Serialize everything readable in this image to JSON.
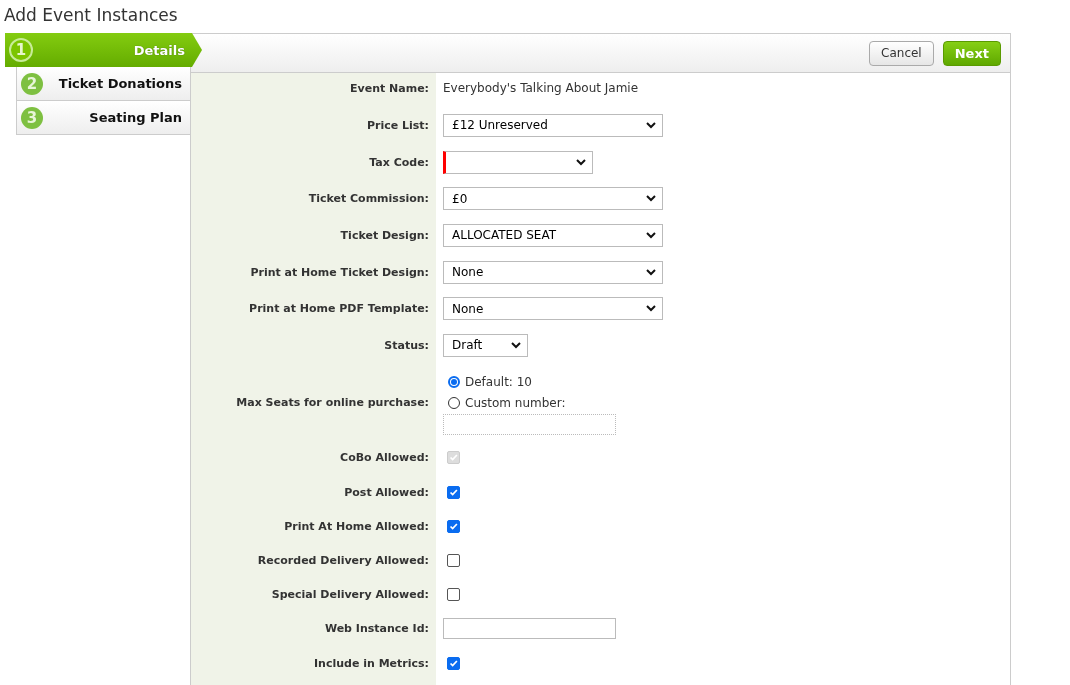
{
  "page_title": "Add Event Instances",
  "steps": [
    {
      "number": "1",
      "label": "Details",
      "selected": true
    },
    {
      "number": "2",
      "label": "Ticket Donations",
      "selected": false
    },
    {
      "number": "3",
      "label": "Seating Plan",
      "selected": false
    }
  ],
  "buttons": [
    {
      "label": "Cancel",
      "kind": "secondary"
    },
    {
      "label": "Next",
      "kind": "primary"
    }
  ],
  "fields": [
    {
      "kind": "text",
      "label": "Event Name:",
      "value": "Everybody's Talking About Jamie"
    },
    {
      "kind": "select",
      "label": "Price List:",
      "value": "£12 Unreserved",
      "invalid": false
    },
    {
      "kind": "select",
      "label": "Tax Code:",
      "invalid": true
    },
    {
      "kind": "select",
      "label": "Ticket Commission:",
      "value": "£0",
      "invalid": false
    },
    {
      "kind": "select",
      "label": "Ticket Design:",
      "value": "ALLOCATED SEAT",
      "invalid": false
    },
    {
      "kind": "select",
      "label": "Print at Home Ticket Design:",
      "value": "None",
      "invalid": false
    },
    {
      "kind": "select",
      "label": "Print at Home PDF Template:",
      "value": "None",
      "invalid": false
    },
    {
      "kind": "select",
      "label": "Status:",
      "value": "Draft",
      "invalid": false
    },
    {
      "kind": "radio",
      "label": "Max Seats for online purchase:",
      "options": [
        {
          "label": "Default: 10",
          "selected": true
        },
        {
          "label": "Custom number:",
          "selected": false
        }
      ],
      "custom_input": {
        "disabled": true
      }
    },
    {
      "kind": "checkbox",
      "label": "CoBo Allowed:",
      "checked": true,
      "disabled": true
    },
    {
      "kind": "checkbox",
      "label": "Post Allowed:",
      "checked": true,
      "disabled": false
    },
    {
      "kind": "checkbox",
      "label": "Print At Home Allowed:",
      "checked": true,
      "disabled": false
    },
    {
      "kind": "checkbox",
      "label": "Recorded Delivery Allowed:",
      "checked": false,
      "disabled": false
    },
    {
      "kind": "checkbox",
      "label": "Special Delivery Allowed:",
      "checked": false,
      "disabled": false
    },
    {
      "kind": "input",
      "label": "Web Instance Id:"
    },
    {
      "kind": "checkbox",
      "label": "Include in Metrics:",
      "checked": true,
      "disabled": false
    }
  ]
}
